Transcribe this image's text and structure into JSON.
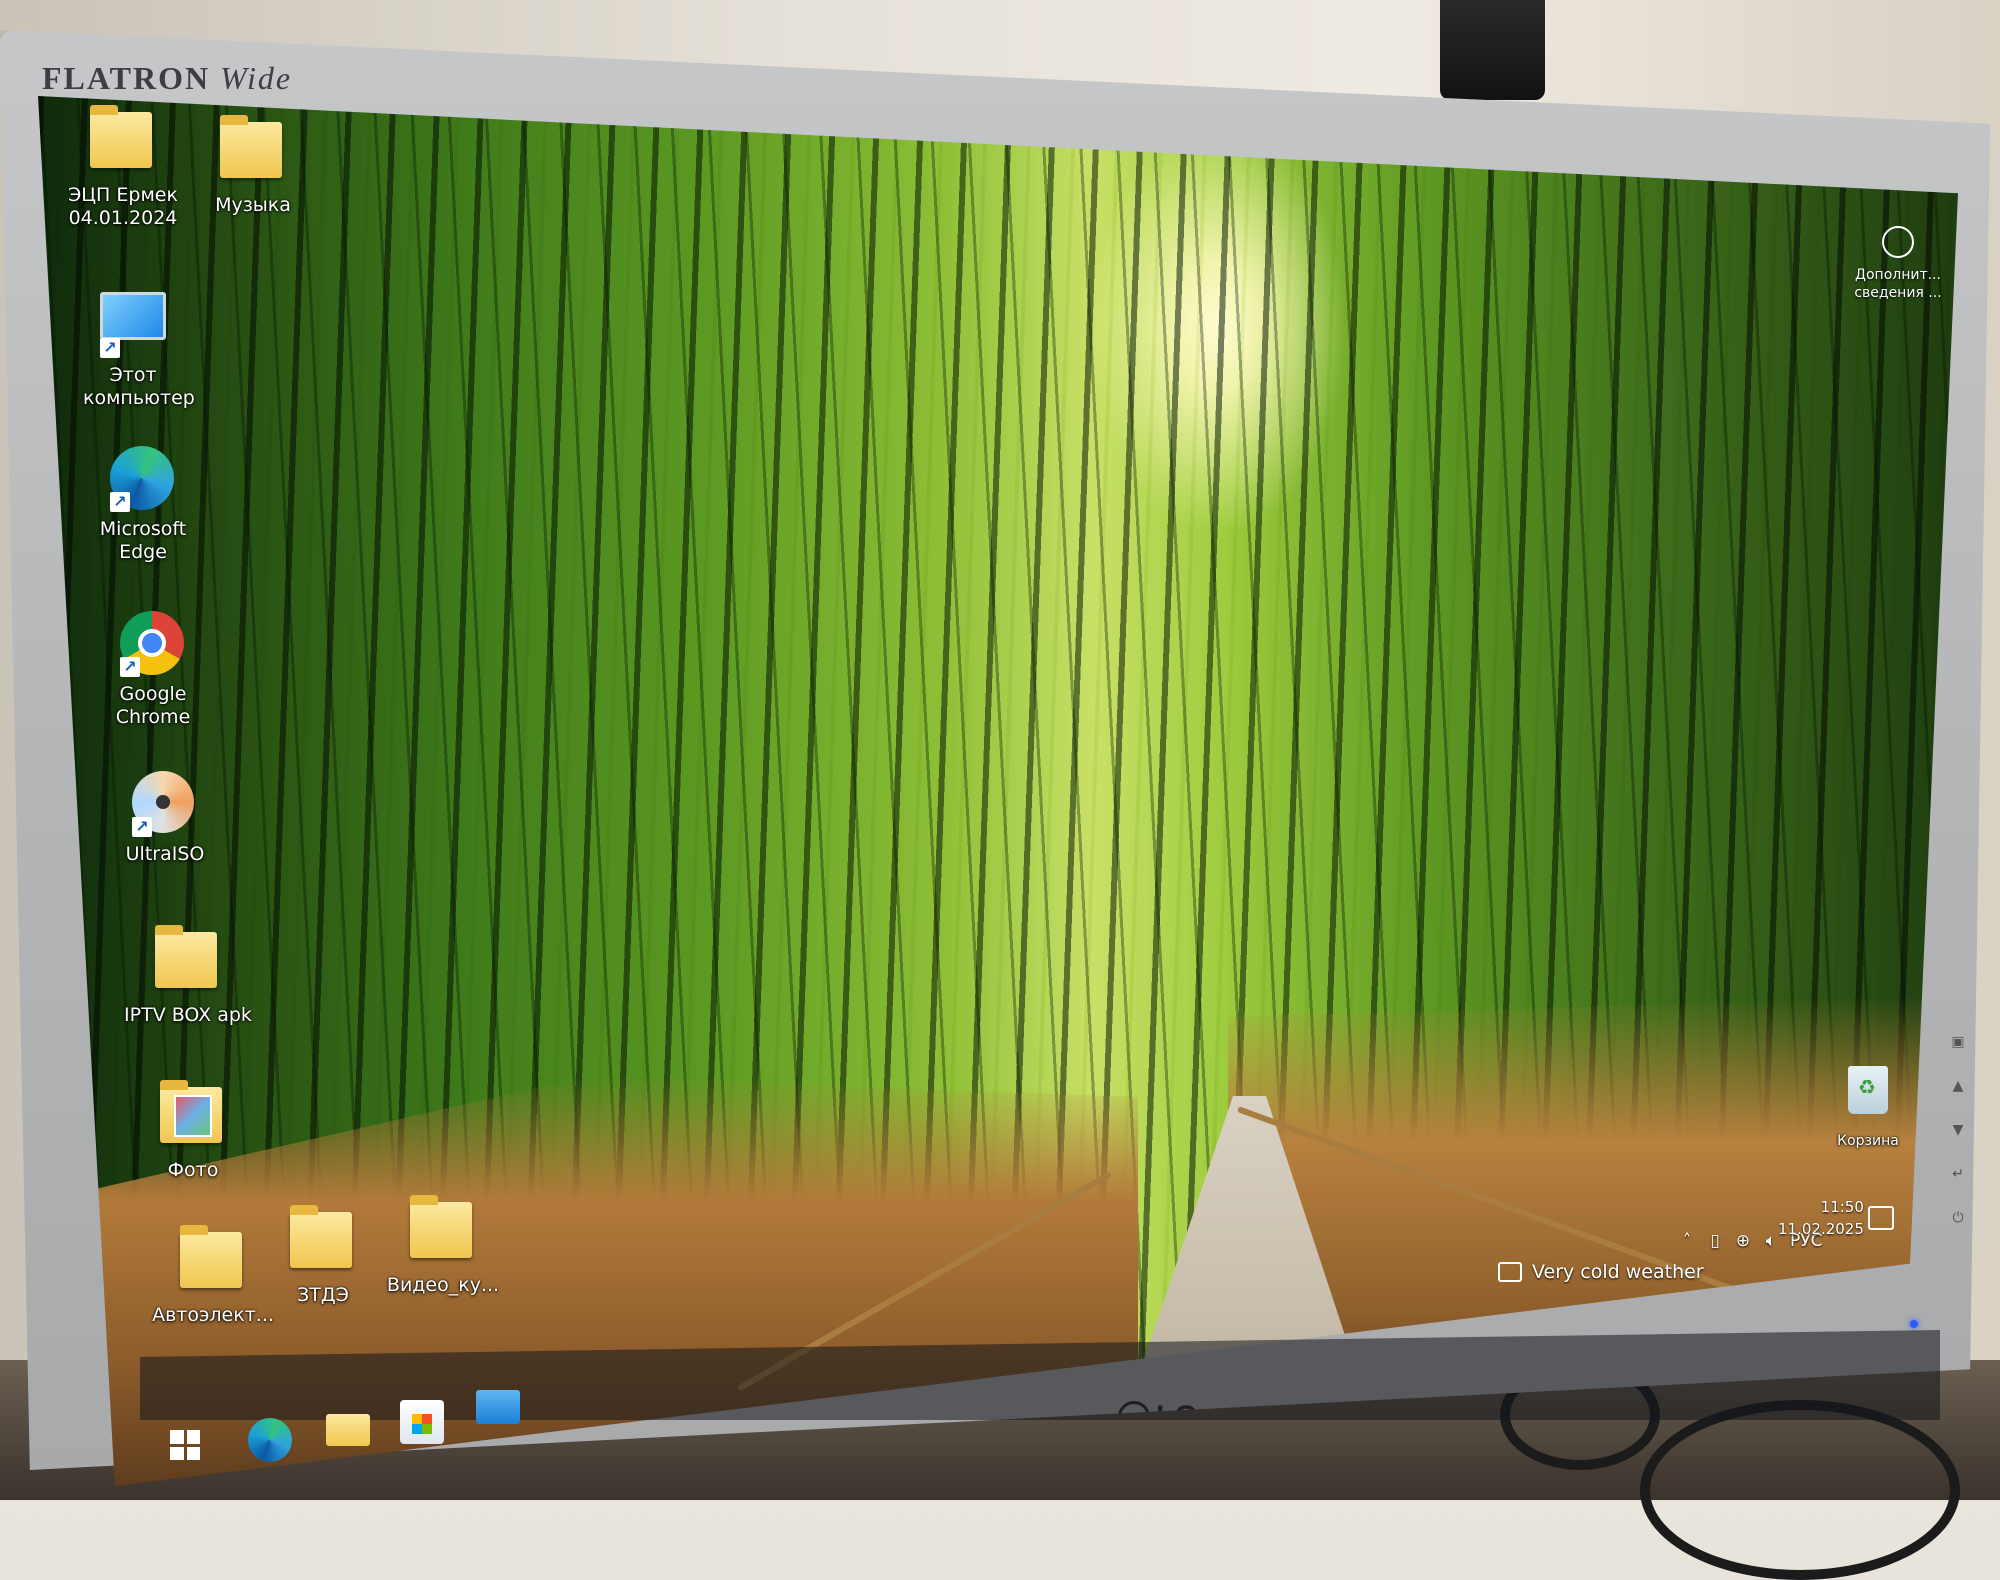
{
  "monitor": {
    "brand": "FLATRON",
    "brand_model": "Wide",
    "maker_logo": "LG"
  },
  "desktop_icons": [
    {
      "label": "ЭЦП Ермек 04.01.2024",
      "icon": "folder-icon"
    },
    {
      "label": "Музыка",
      "icon": "music-folder-icon"
    },
    {
      "label": "Этот компьютер",
      "icon": "this-pc-icon"
    },
    {
      "label": "Microsoft Edge",
      "icon": "edge-icon"
    },
    {
      "label": "Google Chrome",
      "icon": "chrome-icon"
    },
    {
      "label": "UltraISO",
      "icon": "disc-icon"
    },
    {
      "label": "IPTV BOX apk",
      "icon": "folder-icon"
    },
    {
      "label": "Фото",
      "icon": "photo-folder-icon"
    },
    {
      "label": "Автоэлект...",
      "icon": "folder-icon"
    },
    {
      "label": "ЗТДЭ",
      "icon": "folder-icon"
    },
    {
      "label": "Видео_ку...",
      "icon": "folder-icon"
    },
    {
      "label": "Корзина",
      "icon": "recycle-bin-icon"
    }
  ],
  "info_widget": {
    "line1": "Дополнит...",
    "line2": "сведения ..."
  },
  "taskbar": {
    "apps": [
      "start-icon",
      "edge-icon",
      "file-explorer-icon",
      "store-icon",
      "mail-icon"
    ],
    "weather": "Very cold weather",
    "language": "РУС",
    "time": "11:50",
    "date": "11.02.2025"
  }
}
